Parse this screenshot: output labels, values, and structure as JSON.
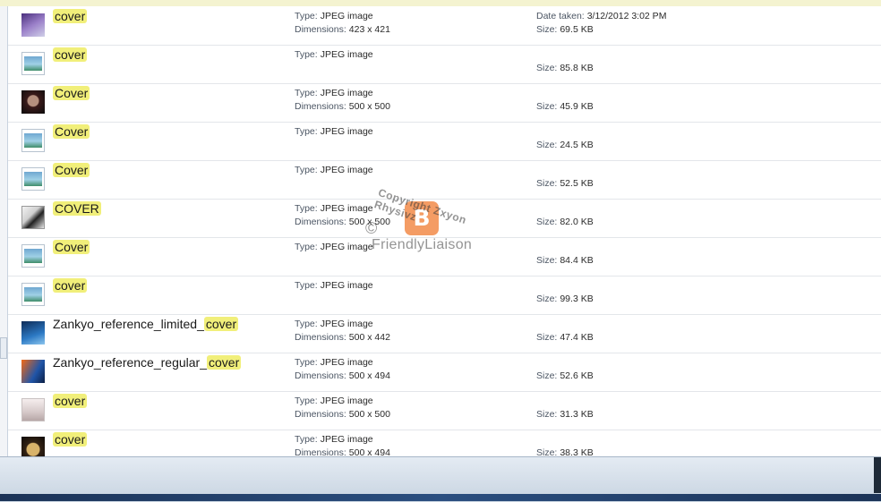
{
  "labels": {
    "type": "Type:",
    "dimensions": "Dimensions:",
    "date_taken": "Date taken:",
    "size": "Size:"
  },
  "watermark": {
    "copyright_symbol": "©",
    "arc_text": "Copyright Zxyon Rhysivz",
    "brand": "FriendlyLiaison",
    "logo_icon": "blogger-icon"
  },
  "files": [
    {
      "prefix": "",
      "match": "cover",
      "thumb": "purple",
      "thumb_icon": "image-thumbnail-icon",
      "type": "JPEG image",
      "dimensions": "423 x 421",
      "date_taken": "3/12/2012 3:02 PM",
      "size": "69.5 KB"
    },
    {
      "prefix": "",
      "match": "cover",
      "thumb": "generic",
      "thumb_icon": "generic-image-icon",
      "type": "JPEG image",
      "dimensions": "",
      "date_taken": "",
      "size": "85.8 KB"
    },
    {
      "prefix": "",
      "match": "Cover",
      "thumb": "dark",
      "thumb_icon": "image-thumbnail-icon",
      "type": "JPEG image",
      "dimensions": "500 x 500",
      "date_taken": "",
      "size": "45.9 KB"
    },
    {
      "prefix": "",
      "match": "Cover",
      "thumb": "generic",
      "thumb_icon": "generic-image-icon",
      "type": "JPEG image",
      "dimensions": "",
      "date_taken": "",
      "size": "24.5 KB"
    },
    {
      "prefix": "",
      "match": "Cover",
      "thumb": "generic",
      "thumb_icon": "generic-image-icon",
      "type": "JPEG image",
      "dimensions": "",
      "date_taken": "",
      "size": "52.5 KB"
    },
    {
      "prefix": "",
      "match": "COVER",
      "thumb": "manga",
      "thumb_icon": "image-thumbnail-icon",
      "type": "JPEG image",
      "dimensions": "500 x 500",
      "date_taken": "",
      "size": "82.0 KB"
    },
    {
      "prefix": "",
      "match": "Cover",
      "thumb": "generic",
      "thumb_icon": "generic-image-icon",
      "type": "JPEG image",
      "dimensions": "",
      "date_taken": "",
      "size": "84.4 KB"
    },
    {
      "prefix": "",
      "match": "cover",
      "thumb": "generic",
      "thumb_icon": "generic-image-icon",
      "type": "JPEG image",
      "dimensions": "",
      "date_taken": "",
      "size": "99.3 KB"
    },
    {
      "prefix": "Zankyo_reference_limited_",
      "match": "cover",
      "thumb": "blue",
      "thumb_icon": "image-thumbnail-icon",
      "type": "JPEG image",
      "dimensions": "500 x 442",
      "date_taken": "",
      "size": "47.4 KB"
    },
    {
      "prefix": "Zankyo_reference_regular_",
      "match": "cover",
      "thumb": "orange",
      "thumb_icon": "image-thumbnail-icon",
      "type": "JPEG image",
      "dimensions": "500 x 494",
      "date_taken": "",
      "size": "52.6 KB"
    },
    {
      "prefix": "",
      "match": "cover",
      "thumb": "figure",
      "thumb_icon": "image-thumbnail-icon",
      "type": "JPEG image",
      "dimensions": "500 x 500",
      "date_taken": "",
      "size": "31.3 KB"
    },
    {
      "prefix": "",
      "match": "cover",
      "thumb": "gold",
      "thumb_icon": "image-thumbnail-icon",
      "type": "JPEG image",
      "dimensions": "500 x 494",
      "date_taken": "",
      "size": "38.3 KB"
    }
  ]
}
